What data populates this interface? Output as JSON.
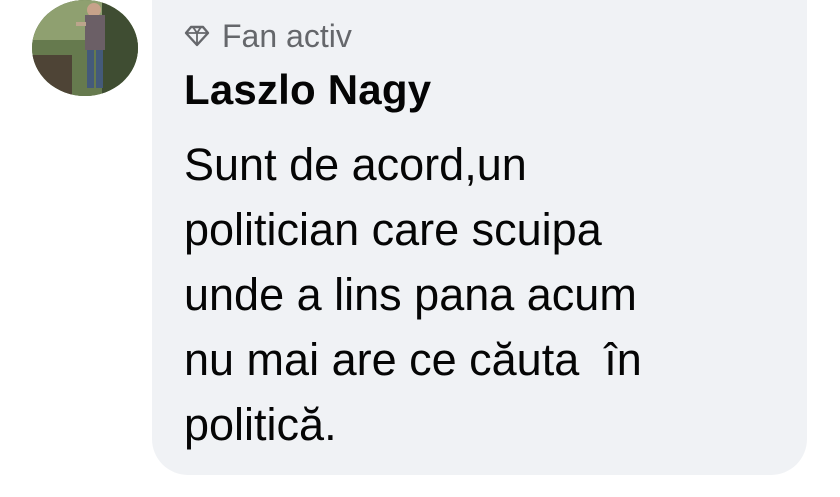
{
  "comment": {
    "badge": {
      "icon": "diamond-icon",
      "label": "Fan activ"
    },
    "author": "Laszlo Nagy",
    "text_lines": [
      "Sunt de acord,un",
      "politician care scuipa",
      "unde a lins pana acum",
      "nu mai are ce căuta  în",
      "politică."
    ],
    "avatar": {
      "icon": "profile-photo"
    }
  },
  "colors": {
    "bubble": "#f0f2f5",
    "author": "#050505",
    "badge": "#65676b"
  }
}
